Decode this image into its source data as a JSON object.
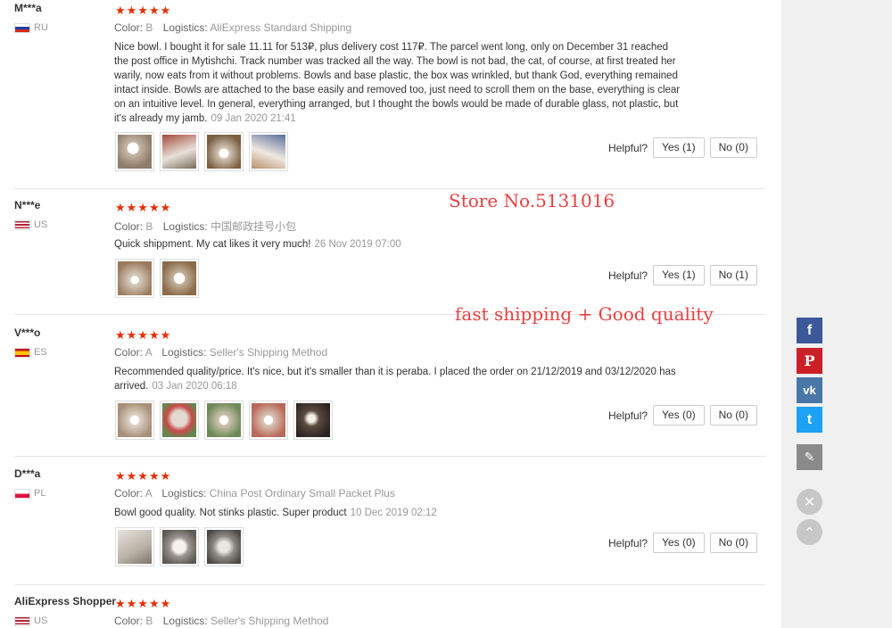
{
  "labels": {
    "color": "Color:",
    "logistics": "Logistics:",
    "helpful": "Helpful?"
  },
  "reviews": [
    {
      "user": "M***a",
      "country": "RU",
      "stars": "★★★★★",
      "color": "B",
      "logistics": "AliExpress Standard Shipping",
      "text": "Nice bowl. I bought it for sale 11.11 for 513₽, plus delivery cost 117₽. The parcel went long, only on December 31 reached the post office in Mytishchi. Track number was tracked all the way. The bowl is not bad, the cat, of course, at first treated her warily, now eats from it without problems. Bowls and base plastic, the box was wrinkled, but thank God, everything remained intact inside. Bowls are attached to the base easily and removed too, just need to scroll them on the base, everything is clear on an intuitive level. In general, everything arranged, but I thought the bowls would be made of durable glass, not plastic, but it's already my jamb.",
      "date": "09 Jan 2020 21:41",
      "yes": "Yes (1)",
      "no": "No (0)"
    },
    {
      "user": "N***e",
      "country": "US",
      "stars": "★★★★★",
      "color": "B",
      "logistics": "中国邮政挂号小包",
      "text": "Quick shippment. My cat likes it very much!",
      "date": "26 Nov 2019 07:00",
      "yes": "Yes (1)",
      "no": "No (1)"
    },
    {
      "user": "V***o",
      "country": "ES",
      "stars": "★★★★★",
      "color": "A",
      "logistics": "Seller's Shipping Method",
      "text": "Recommended quality/price. It's nice, but it's smaller than it is peraba. I placed the order on 21/12/2019 and 03/12/2020 has arrived.",
      "date": "03 Jan 2020 06:18",
      "yes": "Yes (0)",
      "no": "No (0)"
    },
    {
      "user": "D***a",
      "country": "PL",
      "stars": "★★★★★",
      "color": "A",
      "logistics": "China Post Ordinary Small Packet Plus",
      "text": "Bowl good quality. Not stinks plastic. Super product",
      "date": "10 Dec 2019 02:12",
      "yes": "Yes (0)",
      "no": "No (0)"
    },
    {
      "user": "AliExpress Shopper",
      "country": "US",
      "stars": "★★★★★",
      "color": "B",
      "logistics": "Seller's Shipping Method"
    }
  ],
  "overlay": {
    "store": "Store No.5131016",
    "tagline": "fast shipping + Good quality"
  },
  "share": {
    "facebook": "f",
    "pinterest": "P",
    "vk": "vk",
    "twitter": "t",
    "edit": "✎",
    "close": "✕",
    "up": "⌃"
  },
  "colors": {
    "star": "#e62e04",
    "overlay_text": "#e84040",
    "facebook": "#3b5998",
    "pinterest": "#cb2027",
    "vk": "#4a76a8",
    "twitter": "#1da1f2",
    "edit": "#8a8a8a"
  }
}
